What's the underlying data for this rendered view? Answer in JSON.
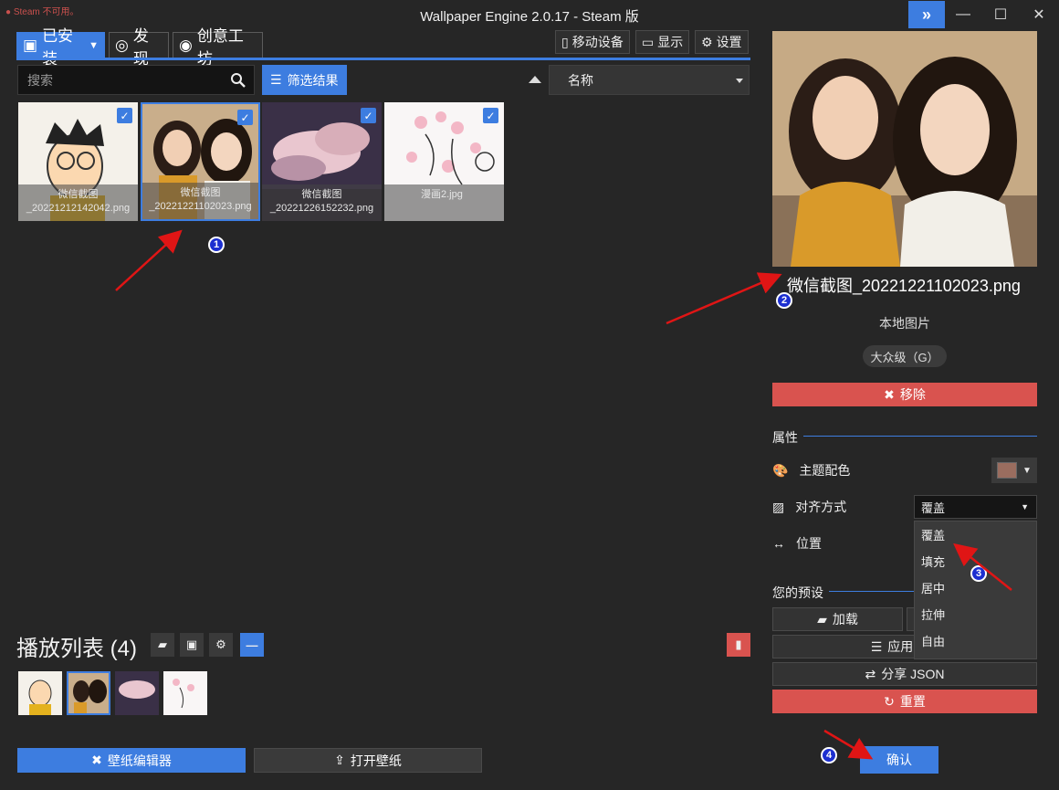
{
  "window": {
    "title": "Wallpaper Engine 2.0.17 - Steam 版",
    "steam_warning": "Steam 不可用。"
  },
  "tabs": [
    {
      "label": "已安装"
    },
    {
      "label": "发现"
    },
    {
      "label": "创意工坊"
    }
  ],
  "top_buttons": {
    "mobile": "移动设备",
    "display": "显示",
    "settings": "设置"
  },
  "search": {
    "placeholder": "搜索"
  },
  "filter_label": "筛选结果",
  "sort": {
    "selected": "名称"
  },
  "wallpapers": [
    {
      "line1": "微信截图",
      "line2": "_20221212142042.png"
    },
    {
      "line1": "微信截图",
      "line2": "_20221221102023.png"
    },
    {
      "line1": "微信截图",
      "line2": "_20221226152232.png"
    },
    {
      "line1": "漫画2.jpg",
      "line2": ""
    }
  ],
  "playlist": {
    "title": "播放列表 (4)"
  },
  "bottom_buttons": {
    "editor": "壁纸编辑器",
    "open": "打开壁纸"
  },
  "preview": {
    "name": "微信截图_20221221102023.png",
    "type": "本地图片",
    "rating": "大众级（G）",
    "remove_label": "移除"
  },
  "properties": {
    "header": "属性",
    "theme_color_label": "主题配色",
    "theme_color": "#9a6d5f",
    "align_label": "对齐方式",
    "align_selected": "覆盖",
    "position_label": "位置",
    "align_options": [
      "覆盖",
      "填充",
      "居中",
      "拉伸",
      "自由"
    ]
  },
  "presets": {
    "header": "您的预设",
    "load": "加载",
    "apply": "应用到所",
    "share": "分享 JSON",
    "reset": "重置"
  },
  "confirm_label": "确认",
  "markers": [
    "1",
    "2",
    "3",
    "4"
  ],
  "colors": {
    "accent": "#3d7de0",
    "danger": "#d9534f",
    "background": "#262626"
  }
}
